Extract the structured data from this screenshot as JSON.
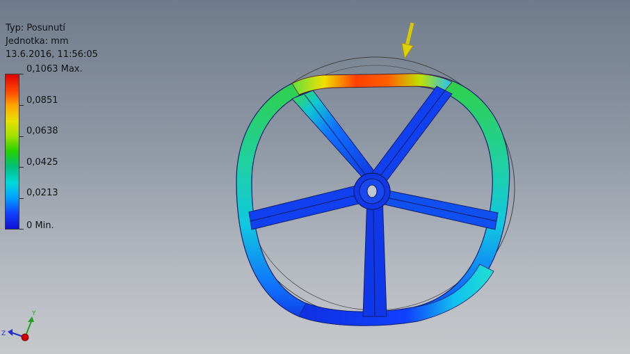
{
  "legend": {
    "type_label": "Typ: Posunutí",
    "unit_label": "Jednotka: mm",
    "date_label": "13.6.2016, 11:56:05",
    "max_label": "0,1063 Max.",
    "min_label": "0 Min.",
    "tick_labels": [
      "0,0851",
      "0,0638",
      "0,0425",
      "0,0213"
    ],
    "max_value": 0.1063,
    "min_value": 0
  },
  "triad": {
    "y_label": "Y",
    "z_label": "Z",
    "colors": {
      "x": "#d00000",
      "y": "#20a020",
      "z": "#2030d0"
    }
  },
  "model": {
    "load_arrow_color": "#e0d000",
    "icons": [
      "load-arrow-icon",
      "wheel-model",
      "undeformed-outline"
    ]
  }
}
